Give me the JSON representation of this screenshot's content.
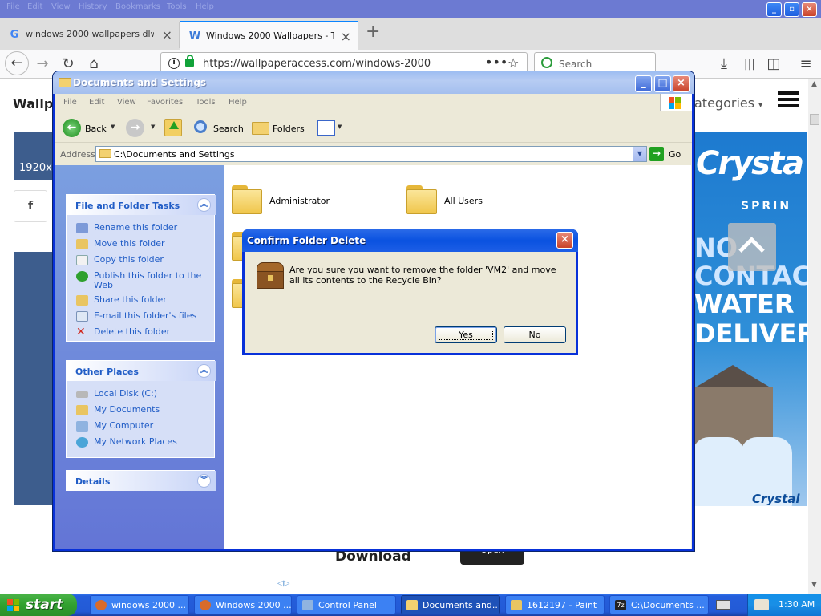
{
  "browser": {
    "menu": [
      "File",
      "Edit",
      "View",
      "History",
      "Bookmarks",
      "Tools",
      "Help"
    ],
    "tabs": [
      {
        "title": "windows 2000 wallpapers dlwnpa",
        "favicon": "google-g-icon",
        "active": false
      },
      {
        "title": "Windows 2000 Wallpapers - Top Fr",
        "favicon": "wallpaperaccess-w-icon",
        "active": true
      }
    ],
    "url": "https://wallpaperaccess.com/windows-2000",
    "search_placeholder": "Search"
  },
  "webpage": {
    "site_title": "Wallpa",
    "categories_label": "ategories",
    "resolution_label": "1920x1",
    "facebook_label": "f",
    "ad": {
      "brand": "Crysta",
      "sub": "SPRIN",
      "line1": "NO",
      "line2": "CONTAC",
      "line3": "WATER",
      "line4": "DELIVER",
      "logo": "Crystal"
    },
    "download_label": "Download",
    "open_label": "Open"
  },
  "explorer": {
    "title": "Documents and Settings",
    "menu": [
      "File",
      "Edit",
      "View",
      "Favorites",
      "Tools",
      "Help"
    ],
    "toolbar": {
      "back": "Back",
      "search": "Search",
      "folders": "Folders"
    },
    "address_label": "Address",
    "address_value": "C:\\Documents and Settings",
    "go_label": "Go",
    "file_tasks": {
      "title": "File and Folder Tasks",
      "items": [
        {
          "label": "Rename this folder",
          "icon": "rename-icon"
        },
        {
          "label": "Move this folder",
          "icon": "move-icon"
        },
        {
          "label": "Copy this folder",
          "icon": "copy-icon"
        },
        {
          "label": "Publish this folder to the Web",
          "icon": "publish-web-icon"
        },
        {
          "label": "Share this folder",
          "icon": "share-icon"
        },
        {
          "label": "E-mail this folder's files",
          "icon": "email-icon"
        },
        {
          "label": "Delete this folder",
          "icon": "delete-icon"
        }
      ]
    },
    "other_places": {
      "title": "Other Places",
      "items": [
        {
          "label": "Local Disk (C:)",
          "icon": "local-disk-icon"
        },
        {
          "label": "My Documents",
          "icon": "my-documents-icon"
        },
        {
          "label": "My Computer",
          "icon": "my-computer-icon"
        },
        {
          "label": "My Network Places",
          "icon": "network-places-icon"
        }
      ]
    },
    "details_title": "Details",
    "folders": [
      "Administrator",
      "All Users"
    ]
  },
  "dialog": {
    "title": "Confirm Folder Delete",
    "message": "Are you sure you want to remove the folder 'VM2' and move all its contents to the Recycle Bin?",
    "yes_label": "Yes",
    "no_label": "No"
  },
  "taskbar": {
    "start_label": "start",
    "items": [
      {
        "label": "windows 2000 ...",
        "icon": "firefox-icon",
        "active": false
      },
      {
        "label": "Windows 2000 ...",
        "icon": "firefox-icon",
        "active": false
      },
      {
        "label": "Control Panel",
        "icon": "control-panel-icon",
        "active": false
      },
      {
        "label": "Documents and...",
        "icon": "folder-icon",
        "active": true
      },
      {
        "label": "1612197 - Paint",
        "icon": "paint-icon",
        "active": false
      },
      {
        "label": "C:\\Documents ...",
        "icon": "7zip-icon",
        "active": false
      }
    ],
    "clock": "1:30 AM"
  },
  "colors": {
    "xp_blue": "#0831d9",
    "taskbar_blue": "#245edb",
    "start_green": "#31a12f",
    "task_link": "#215dc6"
  }
}
